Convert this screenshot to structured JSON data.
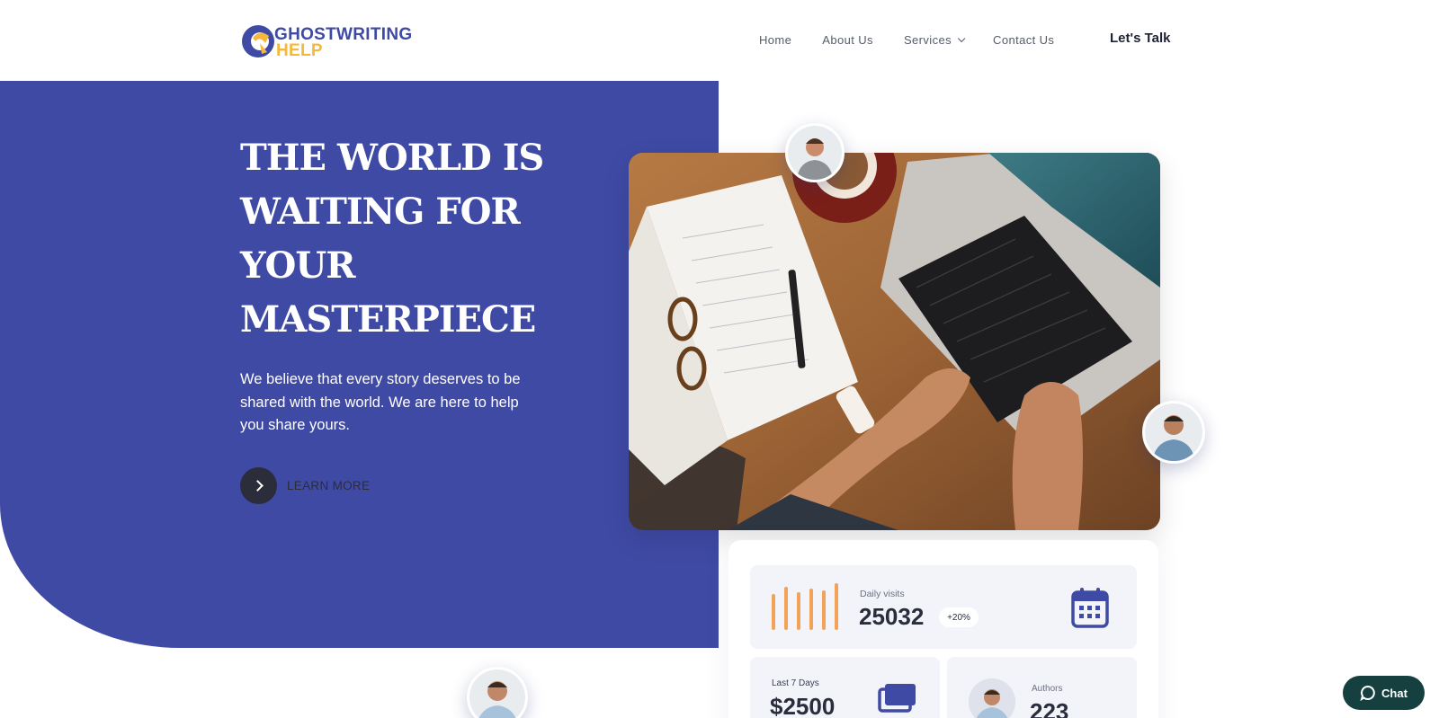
{
  "brand": {
    "line1": "GHOSTWRITING",
    "line2": "HELP",
    "primary_color": "#3f4aa5",
    "accent_color": "#f6b83a"
  },
  "nav": {
    "items": [
      {
        "label": "Home"
      },
      {
        "label": "About Us"
      },
      {
        "label": "Services",
        "has_dropdown": true
      },
      {
        "label": "Contact Us"
      }
    ],
    "cta_label": "Let's Talk"
  },
  "hero": {
    "title_lines": [
      "THE WORLD IS",
      "WAITING FOR",
      "YOUR",
      "MASTERPIECE"
    ],
    "subtitle": "We believe that every story deserves to be shared with the world. We are here to help you share yours.",
    "learn_more_label": "LEARN MORE",
    "background_color": "#3f4aa5"
  },
  "stats": {
    "daily_visits": {
      "label": "Daily visits",
      "value": "25032",
      "change": "+20%",
      "icon": "calendar-icon"
    },
    "last_7_days": {
      "label": "Last 7 Days",
      "value": "$2500",
      "icon": "money-icon"
    },
    "authors": {
      "label": "Authors",
      "value": "223"
    }
  },
  "chat": {
    "label": "Chat",
    "color": "#16403f"
  }
}
